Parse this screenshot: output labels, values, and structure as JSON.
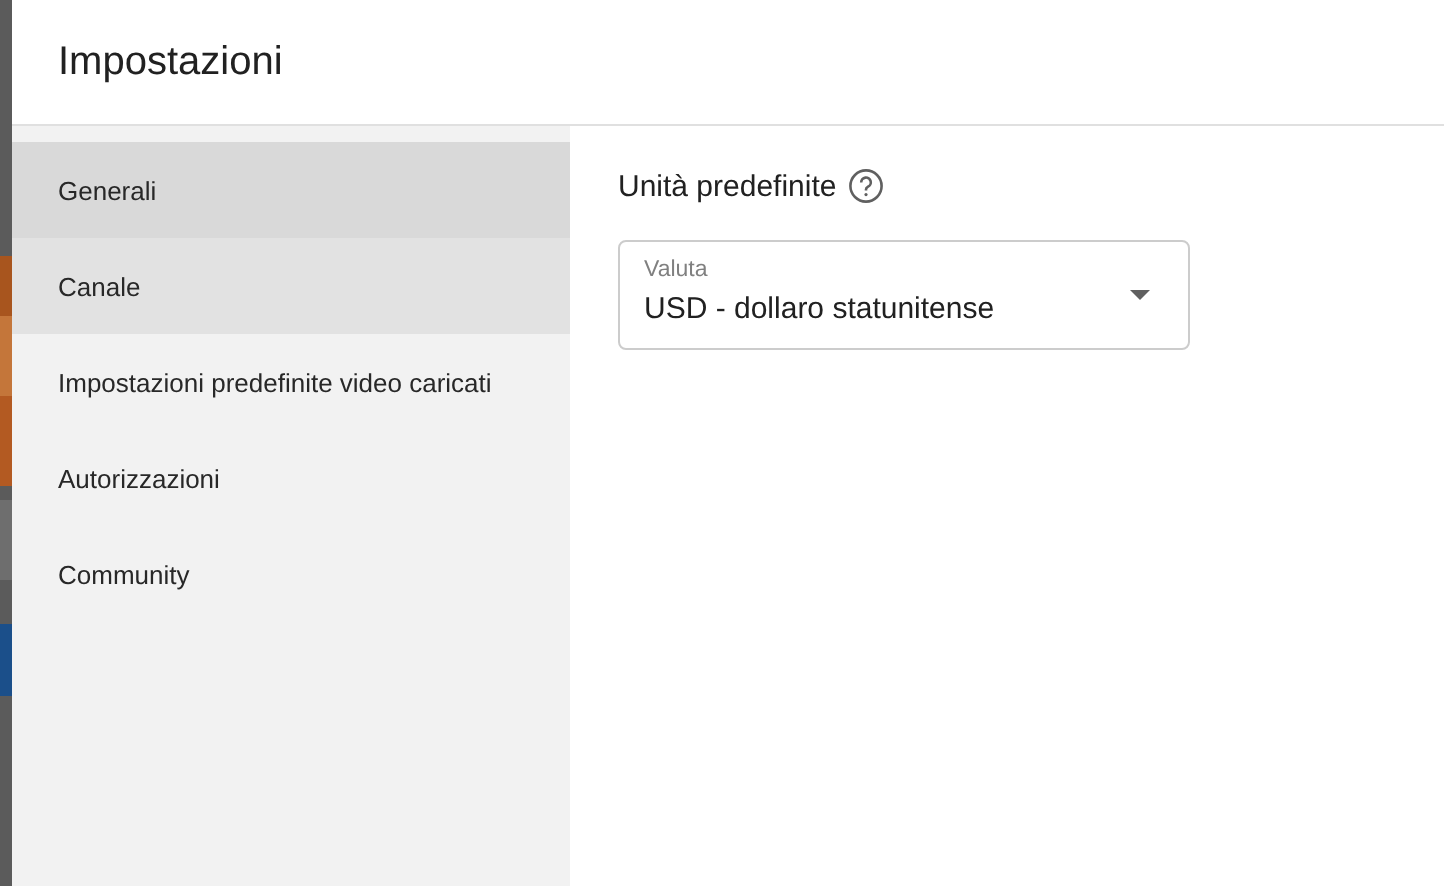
{
  "dialog": {
    "title": "Impostazioni"
  },
  "sidebar": {
    "items": [
      {
        "label": "Generali",
        "selected": true,
        "hovered": false
      },
      {
        "label": "Canale",
        "selected": false,
        "hovered": true
      },
      {
        "label": "Impostazioni predefinite video caricati",
        "selected": false,
        "hovered": false
      },
      {
        "label": "Autorizzazioni",
        "selected": false,
        "hovered": false
      },
      {
        "label": "Community",
        "selected": false,
        "hovered": false
      }
    ]
  },
  "content": {
    "section_title": "Unità predefinite",
    "currency_select": {
      "label": "Valuta",
      "value": "USD - dollaro statunitense"
    }
  }
}
